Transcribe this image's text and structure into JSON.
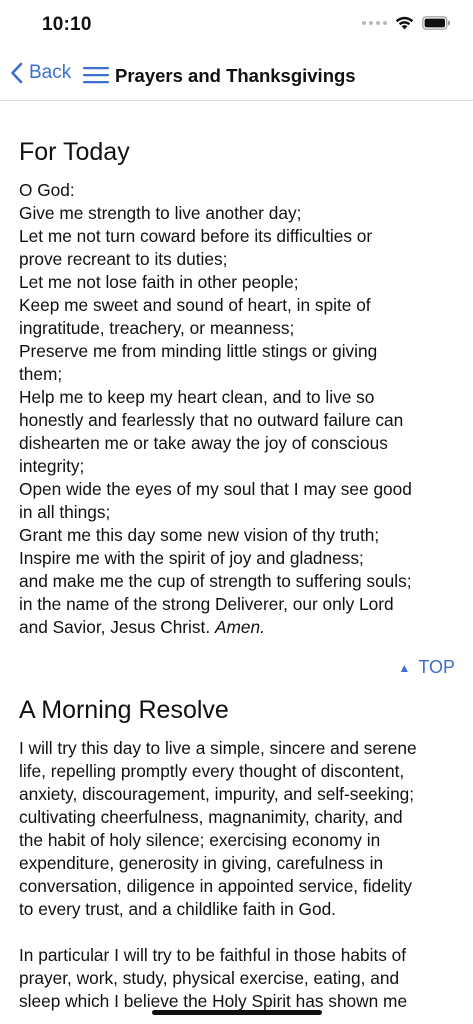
{
  "status_bar": {
    "time": "10:10",
    "icons": [
      "signal-dots-icon",
      "wifi-icon",
      "battery-icon"
    ]
  },
  "nav": {
    "back_label": "Back",
    "title": "Prayers and Thanksgivings",
    "accent_color": "#3a6fd0"
  },
  "sections": [
    {
      "title": "For Today",
      "lines": [
        "O God:",
        "Give me strength to live another day;",
        "Let me not turn coward before its difficulties or",
        "prove recreant to its duties;",
        "Let me not lose faith in other people;",
        "Keep me sweet and sound of heart, in spite of",
        "ingratitude, treachery, or meanness;",
        "Preserve me from minding little stings or giving",
        "them;",
        "Help me to keep my heart clean, and to live so",
        "honestly and fearlessly that no outward failure can",
        "dishearten me or take away the joy of conscious",
        "integrity;",
        "Open wide the eyes of my soul that I may see good",
        "in all things;",
        "Grant me this day some new vision of thy truth;",
        "Inspire me with the spirit of joy and gladness;",
        "and make me the cup of strength to suffering souls;",
        "in the name of the strong Deliverer, our only Lord",
        "and Savior, Jesus Christ."
      ],
      "amen": "Amen.",
      "top_label": "TOP"
    },
    {
      "title": "A Morning Resolve",
      "paragraph1_lines": [
        "I will try this day to live a simple, sincere and serene",
        "life, repelling promptly every thought of discontent,",
        "anxiety, discouragement, impurity, and self-seeking;",
        "cultivating cheerfulness, magnanimity, charity, and",
        "the habit of holy silence; exercising economy in",
        "expenditure, generosity in giving, carefulness in",
        "conversation, diligence in appointed service, fidelity",
        "to every trust, and a childlike faith in God."
      ],
      "paragraph2_lines": [
        "In particular I will try to be faithful in those habits of",
        "prayer, work, study, physical exercise, eating, and",
        "sleep which I believe the Holy Spirit has shown me"
      ]
    }
  ]
}
